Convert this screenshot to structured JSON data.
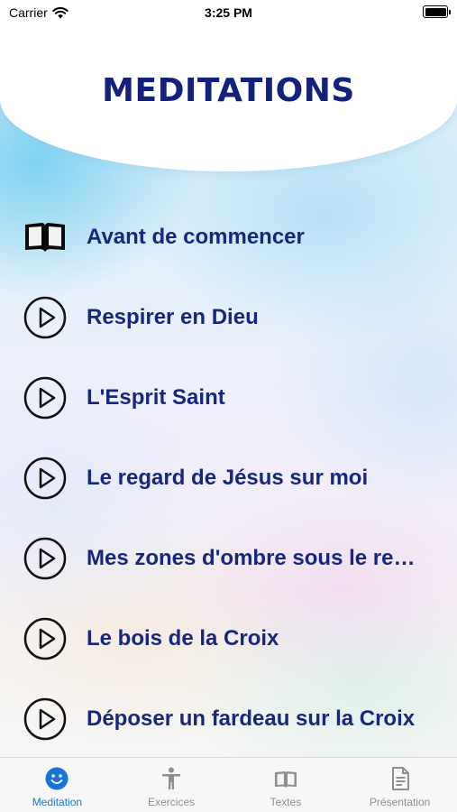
{
  "status_bar": {
    "carrier": "Carrier",
    "time": "3:25 PM"
  },
  "header": {
    "title": "MEDITATIONS"
  },
  "items": [
    {
      "label": "Avant de commencer",
      "icon": "book-icon"
    },
    {
      "label": "Respirer en Dieu",
      "icon": "play-icon"
    },
    {
      "label": "L'Esprit Saint",
      "icon": "play-icon"
    },
    {
      "label": "Le regard de Jésus sur moi",
      "icon": "play-icon"
    },
    {
      "label": "Mes zones d'ombre sous le re…",
      "icon": "play-icon"
    },
    {
      "label": "Le bois de la Croix",
      "icon": "play-icon"
    },
    {
      "label": "Déposer un fardeau sur la Croix",
      "icon": "play-icon"
    }
  ],
  "tabs": [
    {
      "label": "Meditation",
      "icon": "smiley-icon",
      "active": true
    },
    {
      "label": "Exercices",
      "icon": "person-icon",
      "active": false
    },
    {
      "label": "Textes",
      "icon": "open-book-icon",
      "active": false
    },
    {
      "label": "Présentation",
      "icon": "document-icon",
      "active": false
    }
  ],
  "colors": {
    "title": "#13207c",
    "item_text": "#17277e",
    "tab_active": "#1a73d9",
    "tab_inactive": "#8e8e93"
  }
}
